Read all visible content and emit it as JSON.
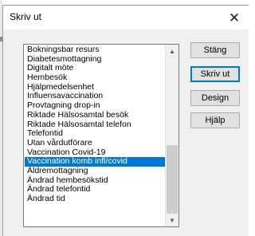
{
  "dialog": {
    "title": "Skriv ut",
    "close_glyph": "✕"
  },
  "list": {
    "items": [
      "Bokningsbar resurs",
      "Diabetesmottagning",
      "Digitalt möte",
      "Hembesök",
      "Hjälpmedelsenhet",
      "Influensavaccination",
      "Provtagning drop-in",
      "Riktade Hälsosamtal besök",
      "Riktade Hälsosamtal telefon",
      "Telefontid",
      "Utan vårdutförare",
      "Vaccination Covid-19",
      "Vaccination komb infl/covid",
      "Äldremottagning",
      "Ändrad hembesökstid",
      "Ändrad telefontid",
      "Ändrad tid"
    ],
    "selected_index": 12,
    "scroll": {
      "thumb_start_fraction": 0.56,
      "thumb_end_fraction": 1.0
    }
  },
  "buttons": {
    "close": "Stäng",
    "print": "Skriv ut",
    "design": "Design",
    "help": "Hjälp"
  },
  "icons": {
    "close": "close-icon",
    "scroll_up": "chevron-up-icon",
    "scroll_down": "chevron-down-icon"
  },
  "colors": {
    "selection": "#0078d7",
    "default_button_border": "#0078d7"
  }
}
